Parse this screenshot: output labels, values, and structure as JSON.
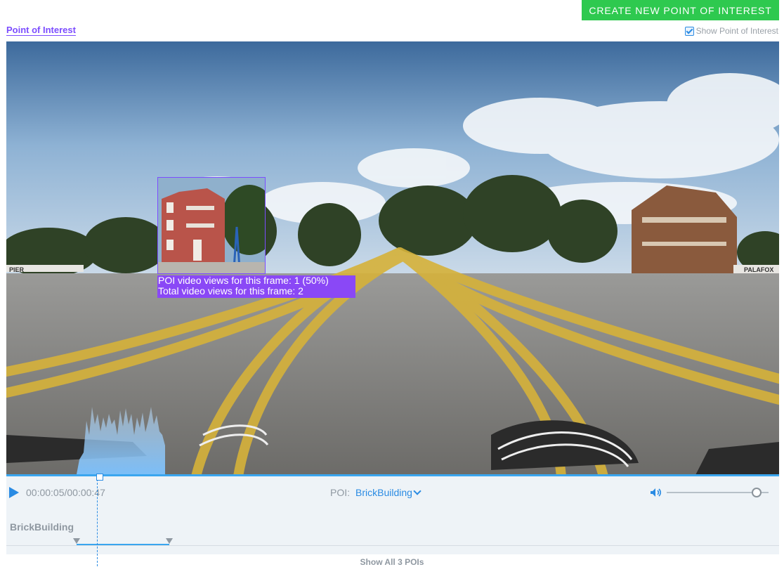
{
  "header": {
    "create_button": "CREATE NEW POINT OF INTEREST",
    "title": "Point of Interest",
    "show_poi_label": "Show Point of Interest",
    "show_poi_checked": true
  },
  "video": {
    "poi_overlay": {
      "line1": "POI video views for this frame: 1 (50%)",
      "line2": "Total video views for this frame: 2"
    },
    "signs": {
      "left": "PIER",
      "right": "PALAFOX"
    }
  },
  "controls": {
    "play_icon": "play-icon",
    "time": "00:00:05/00:00:47",
    "poi_label": "POI:",
    "poi_selected": "BrickBuilding",
    "volume_icon": "volume-icon",
    "volume_level": 0.92
  },
  "timeline": {
    "track_name": "BrickBuilding",
    "show_all_label": "Show All 3 POIs"
  },
  "colors": {
    "accent": "#2a8be3",
    "create_button": "#2ec94f",
    "poi": "#8a48f6"
  }
}
